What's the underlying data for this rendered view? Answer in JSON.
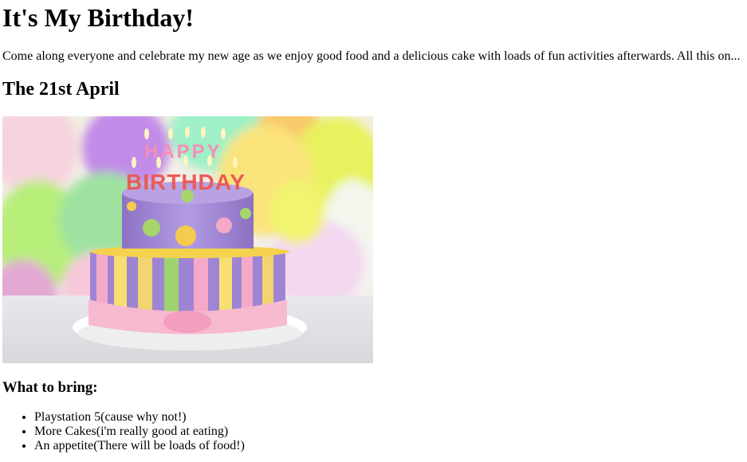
{
  "page": {
    "title": "It's My Birthday!",
    "intro": "Come along everyone and celebrate my new age as we enjoy good food and a delicious cake with loads of fun activities afterwards. All this on...",
    "date_heading": "The 21st April",
    "image": {
      "alt": "birthday cake",
      "topper_line1": "HAPPY",
      "topper_line2": "BIRTHDAY"
    },
    "bring_heading": "What to bring:",
    "bring_items": [
      "Playstation 5(cause why not!)",
      "More Cakes(i'm really good at eating)",
      "An appetite(There will be loads of food!)"
    ]
  },
  "colors": {
    "text": "#000000",
    "background": "#ffffff",
    "cake_purple": "#9f84d4",
    "cake_pink": "#f4a9c9",
    "balloon_yellow": "#e6f05a",
    "balloon_green": "#9fe08a"
  }
}
